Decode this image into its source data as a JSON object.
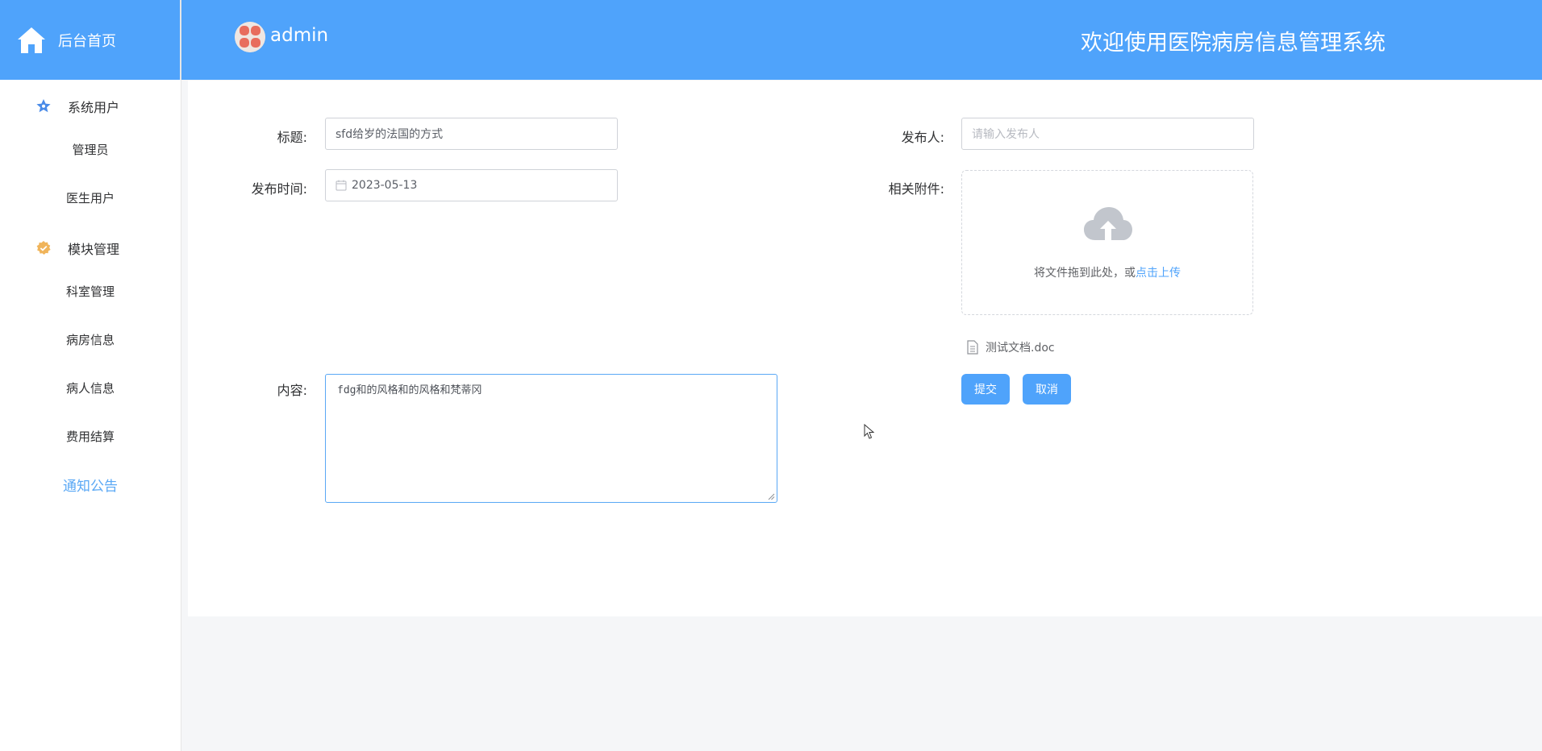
{
  "sidebar": {
    "brand_label": "后台首页",
    "groups": [
      {
        "label": "系统用户",
        "icon": "star-icon",
        "items": [
          "管理员",
          "医生用户"
        ]
      },
      {
        "label": "模块管理",
        "icon": "badge-icon",
        "items": [
          "科室管理",
          "病房信息",
          "病人信息",
          "费用结算",
          "通知公告"
        ]
      }
    ],
    "active_item": "通知公告"
  },
  "header": {
    "username": "admin",
    "welcome": "欢迎使用医院病房信息管理系统"
  },
  "form": {
    "title_label": "标题:",
    "title_value": "sfd给岁的法国的方式",
    "publisher_label": "发布人:",
    "publisher_placeholder": "请输入发布人",
    "time_label": "发布时间:",
    "time_value": "2023-05-13",
    "attachment_label": "相关附件:",
    "upload_hint_prefix": "将文件拖到此处，或",
    "upload_hint_link": "点击上传",
    "file_name": "测试文档.doc",
    "content_label": "内容:",
    "content_value": "fdg和的风格和的风格和梵蒂冈",
    "submit_label": "提交",
    "cancel_label": "取消"
  },
  "colors": {
    "primary": "#4fa3fb",
    "active_menu": "#5aa8f5",
    "page_bg": "#f5f6f8"
  }
}
